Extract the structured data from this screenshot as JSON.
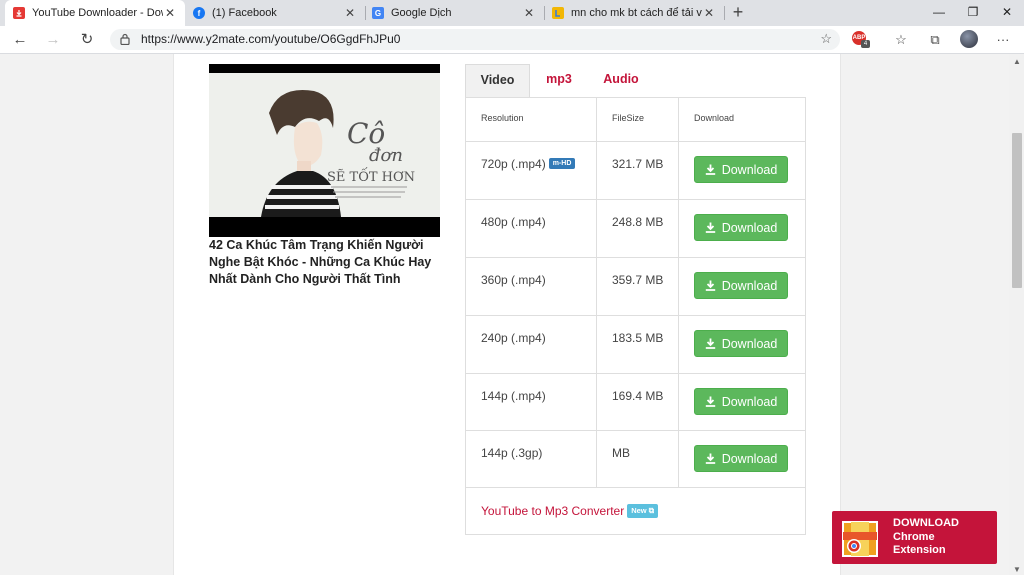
{
  "browser": {
    "tabs": [
      {
        "title": "YouTube Downloader - Downloa",
        "active": true,
        "favicon_color": "#e53935"
      },
      {
        "title": "(1) Facebook",
        "active": false,
        "favicon_color": "#1877f2"
      },
      {
        "title": "Google Dịch",
        "active": false,
        "favicon_color": "#4285f4"
      },
      {
        "title": "mn cho mk bt cách để tải video",
        "active": false,
        "favicon_color": "#f2b705"
      }
    ],
    "url": "https://www.y2mate.com/youtube/O6GgdFhJPu0",
    "adblock_count": "4"
  },
  "video": {
    "title": "42 Ca Khúc Tâm Trạng Khiến Người Nghe Bật Khóc - Những Ca Khúc Hay Nhất Dành Cho Người Thất Tình",
    "thumbnail_text_line1": "Cô",
    "thumbnail_text_line2": "đơn",
    "thumbnail_text_line3": "SẼ TỐT HƠN"
  },
  "format_tabs": [
    {
      "label": "Video",
      "active": true
    },
    {
      "label": "mp3",
      "active": false
    },
    {
      "label": "Audio",
      "active": false
    }
  ],
  "table": {
    "headers": {
      "resolution": "Resolution",
      "filesize": "FileSize",
      "download": "Download"
    },
    "rows": [
      {
        "resolution": "720p (.mp4)",
        "badge": "m-HD",
        "size": "321.7 MB",
        "button": "Download"
      },
      {
        "resolution": "480p (.mp4)",
        "size": "248.8 MB",
        "button": "Download"
      },
      {
        "resolution": "360p (.mp4)",
        "size": "359.7 MB",
        "button": "Download"
      },
      {
        "resolution": "240p (.mp4)",
        "size": "183.5 MB",
        "button": "Download"
      },
      {
        "resolution": "144p (.mp4)",
        "size": "169.4 MB",
        "button": "Download"
      },
      {
        "resolution": "144p (.3gp)",
        "size": "MB",
        "button": "Download"
      }
    ],
    "converter_link": "YouTube to Mp3 Converter",
    "converter_badge": "New"
  },
  "extension_banner": {
    "line1": "DOWNLOAD",
    "line2": "Chrome",
    "line3": "Extension"
  },
  "colors": {
    "accent": "#c4143a",
    "download_green": "#5cb85c",
    "badge_blue": "#337ab7",
    "new_badge": "#5bc0de"
  }
}
